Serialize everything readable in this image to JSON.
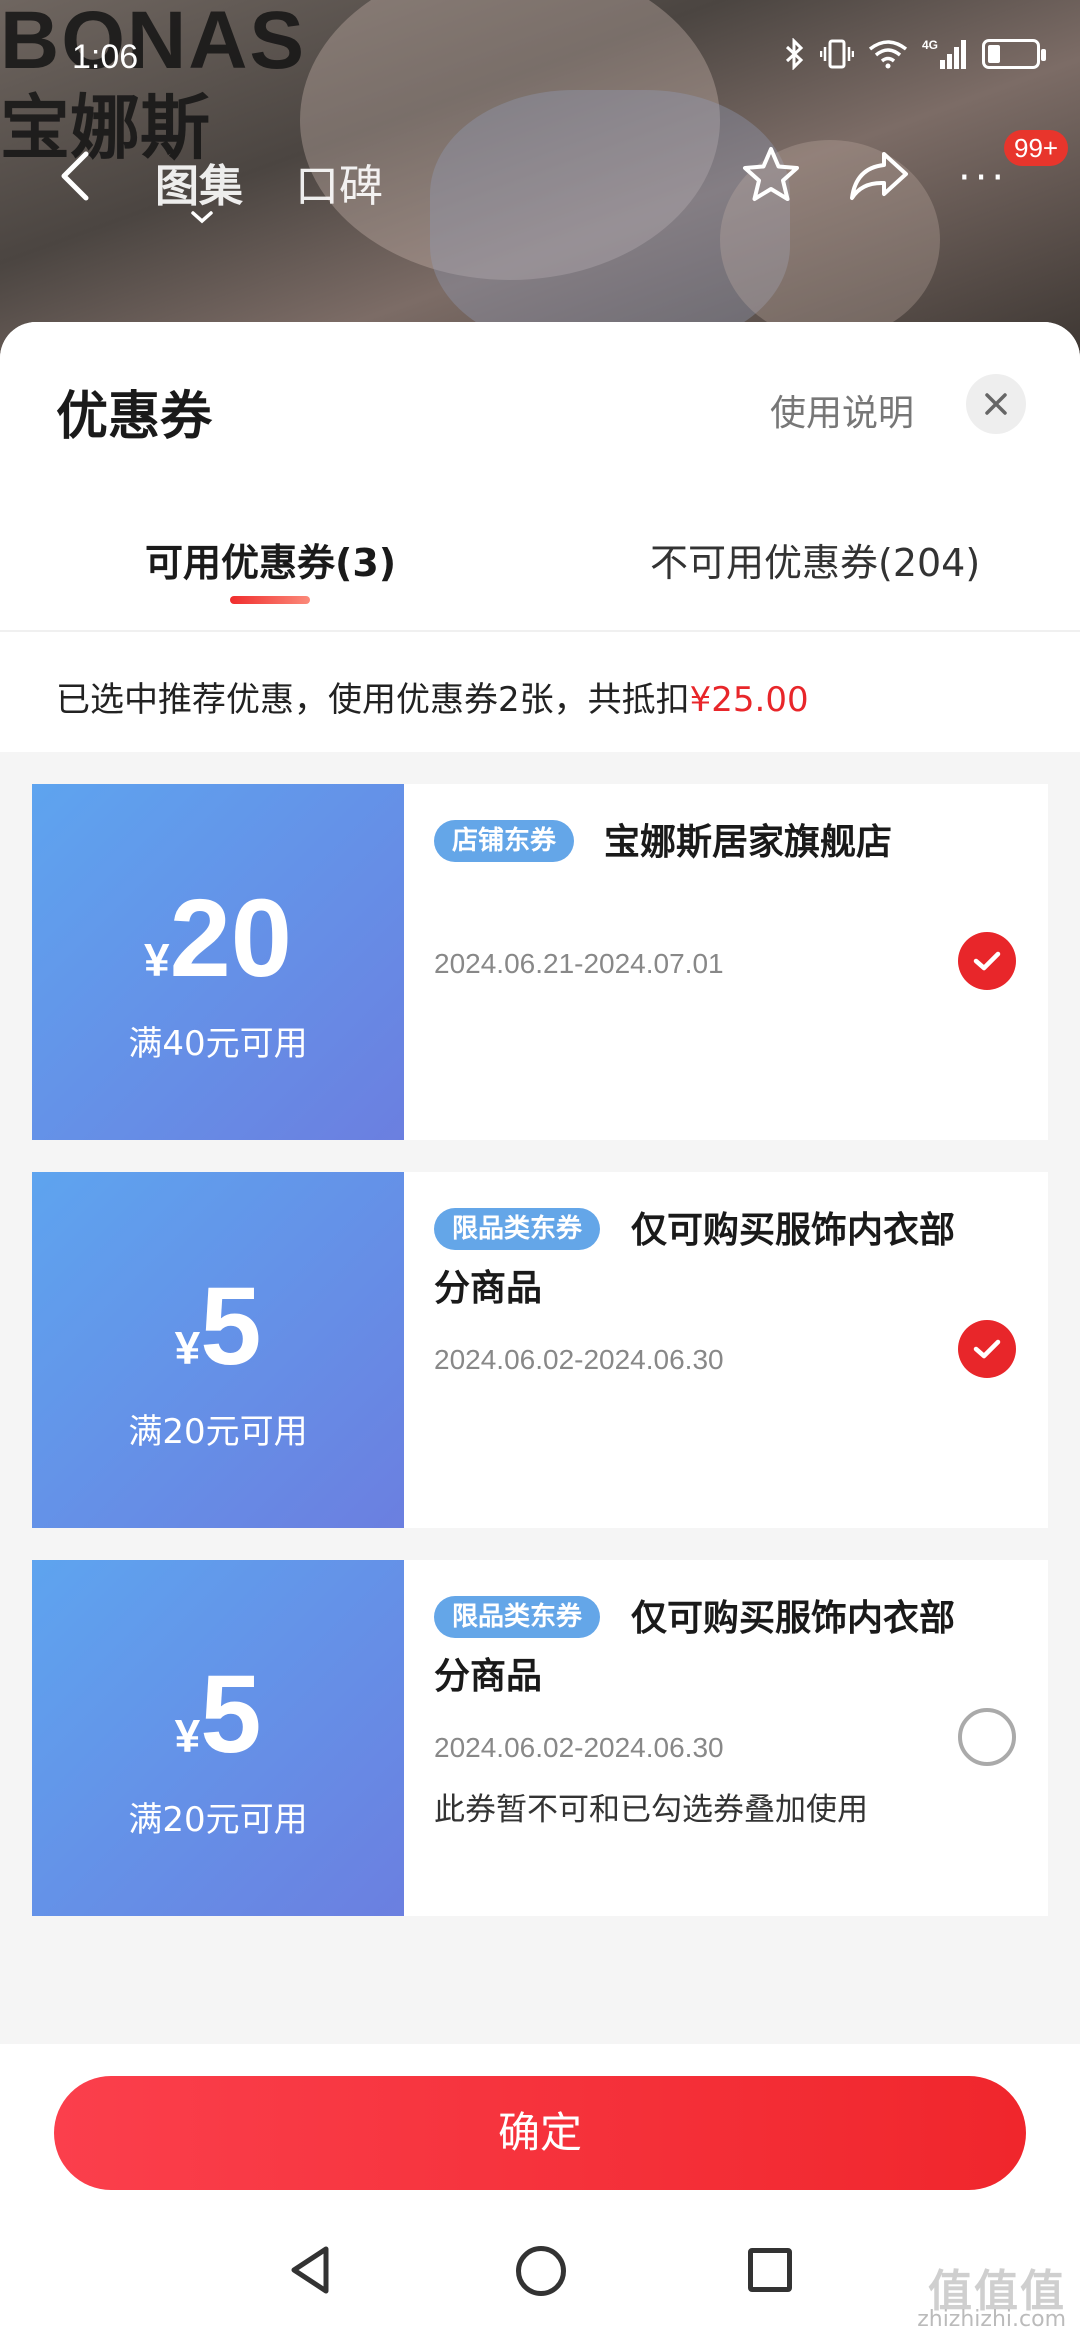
{
  "status_bar": {
    "time": "1:06",
    "network": "4G"
  },
  "background": {
    "brand_en": "BONAS",
    "brand_cn": "宝娜斯",
    "nav": {
      "tab_gallery": "图集",
      "tab_reviews": "口碑",
      "badge": "99+",
      "more": "···"
    }
  },
  "sheet": {
    "title": "优惠券",
    "help_link": "使用说明",
    "tabs": [
      {
        "label": "可用优惠券(3)",
        "active": true
      },
      {
        "label": "不可用优惠券(204)",
        "active": false
      }
    ],
    "summary": {
      "text": "已选中推荐优惠，使用优惠券2张，共抵扣",
      "amount": "¥25.00"
    },
    "coupons": [
      {
        "currency": "¥",
        "amount": "20",
        "condition": "满40元可用",
        "badge": "店铺东券",
        "title": "宝娜斯居家旗舰店",
        "date": "2024.06.21-2024.07.01",
        "note": "",
        "selected": true
      },
      {
        "currency": "¥",
        "amount": "5",
        "condition": "满20元可用",
        "badge": "限品类东券",
        "title": "仅可购买服饰内衣部分商品",
        "date": "2024.06.02-2024.06.30",
        "note": "",
        "selected": true
      },
      {
        "currency": "¥",
        "amount": "5",
        "condition": "满20元可用",
        "badge": "限品类东券",
        "title": "仅可购买服饰内衣部分商品",
        "date": "2024.06.02-2024.06.30",
        "note": "此券暂不可和已勾选券叠加使用",
        "selected": false
      }
    ],
    "confirm_label": "确定"
  },
  "watermark": {
    "big": "值值值",
    "small": "zhizhizhi.com"
  },
  "colors": {
    "accent_red": "#e8262a",
    "coupon_blue_start": "#5ea4ef",
    "coupon_blue_end": "#6b7fe0",
    "badge_blue": "#64a6e8"
  },
  "icons": {
    "nav": [
      "back-arrow-icon",
      "star-icon",
      "share-icon",
      "more-icon"
    ],
    "status": [
      "bluetooth-icon",
      "vibrate-icon",
      "wifi-icon",
      "signal-icon",
      "battery-icon"
    ],
    "sheet": [
      "close-icon",
      "check-icon"
    ],
    "system": [
      "back-triangle-icon",
      "home-circle-icon",
      "recents-square-icon"
    ]
  }
}
